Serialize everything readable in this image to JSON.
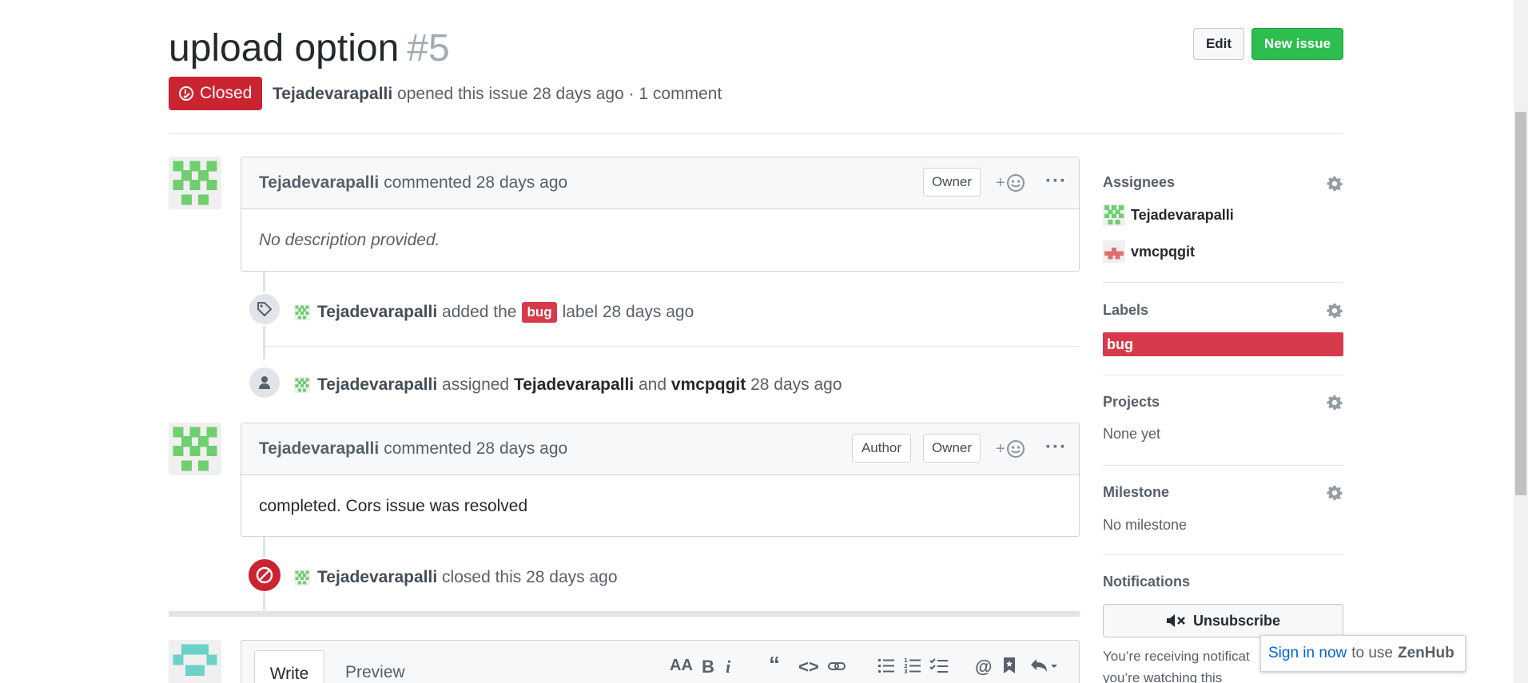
{
  "issue": {
    "title": "upload option",
    "number": "#5",
    "state": "Closed",
    "author": "Tejadevarapalli",
    "meta_text": "opened this issue 28 days ago · 1 comment"
  },
  "header_buttons": {
    "edit": "Edit",
    "new_issue": "New issue"
  },
  "comments": [
    {
      "author": "Tejadevarapalli",
      "action": "commented 28 days ago",
      "badges": [
        "Owner"
      ],
      "body": "No description provided."
    },
    {
      "author": "Tejadevarapalli",
      "action": "commented 28 days ago",
      "badges": [
        "Author",
        "Owner"
      ],
      "body": "completed. Cors issue was resolved"
    }
  ],
  "events": {
    "label": {
      "actor": "Tejadevarapalli",
      "pre": "added the",
      "label": "bug",
      "post": "label 28 days ago"
    },
    "assign": {
      "actor": "Tejadevarapalli",
      "pre": "assigned",
      "user1": "Tejadevarapalli",
      "mid": "and",
      "user2": "vmcpqgit",
      "post": "28 days ago"
    },
    "close": {
      "actor": "Tejadevarapalli",
      "text": "closed this 28 days ago"
    }
  },
  "composer": {
    "tab_write": "Write",
    "tab_preview": "Preview"
  },
  "sidebar": {
    "assignees_heading": "Assignees",
    "assignees": [
      "Tejadevarapalli",
      "vmcpqgit"
    ],
    "labels_heading": "Labels",
    "label": "bug",
    "projects_heading": "Projects",
    "projects_value": "None yet",
    "milestone_heading": "Milestone",
    "milestone_value": "No milestone",
    "notifications_heading": "Notifications",
    "unsubscribe": "Unsubscribe",
    "notif_desc": "You’re receiving notificat you’re watching this repository."
  },
  "zenhub": {
    "link": "Sign in now",
    "text": "to use",
    "brand": "ZenHub"
  },
  "colors": {
    "closed_red": "#cb2431",
    "bug_label": "#d73a4a",
    "new_issue_green": "#2cbe4e",
    "avatar_green": "#6fcf6f",
    "avatar_teal": "#6ad2c6",
    "avatar_red": "#e07070",
    "link_blue": "#0366d6"
  },
  "icons": [
    "issue-closed-icon",
    "tag-icon",
    "person-icon",
    "circle-slash-icon",
    "smiley-icon",
    "kebab-icon",
    "gear-icon",
    "mute-icon",
    "bold-icon",
    "italic-icon",
    "quote-icon",
    "code-icon",
    "link-icon",
    "list-icon",
    "numbered-list-icon",
    "tasklist-icon",
    "mention-icon",
    "bookmark-icon",
    "reply-icon"
  ]
}
